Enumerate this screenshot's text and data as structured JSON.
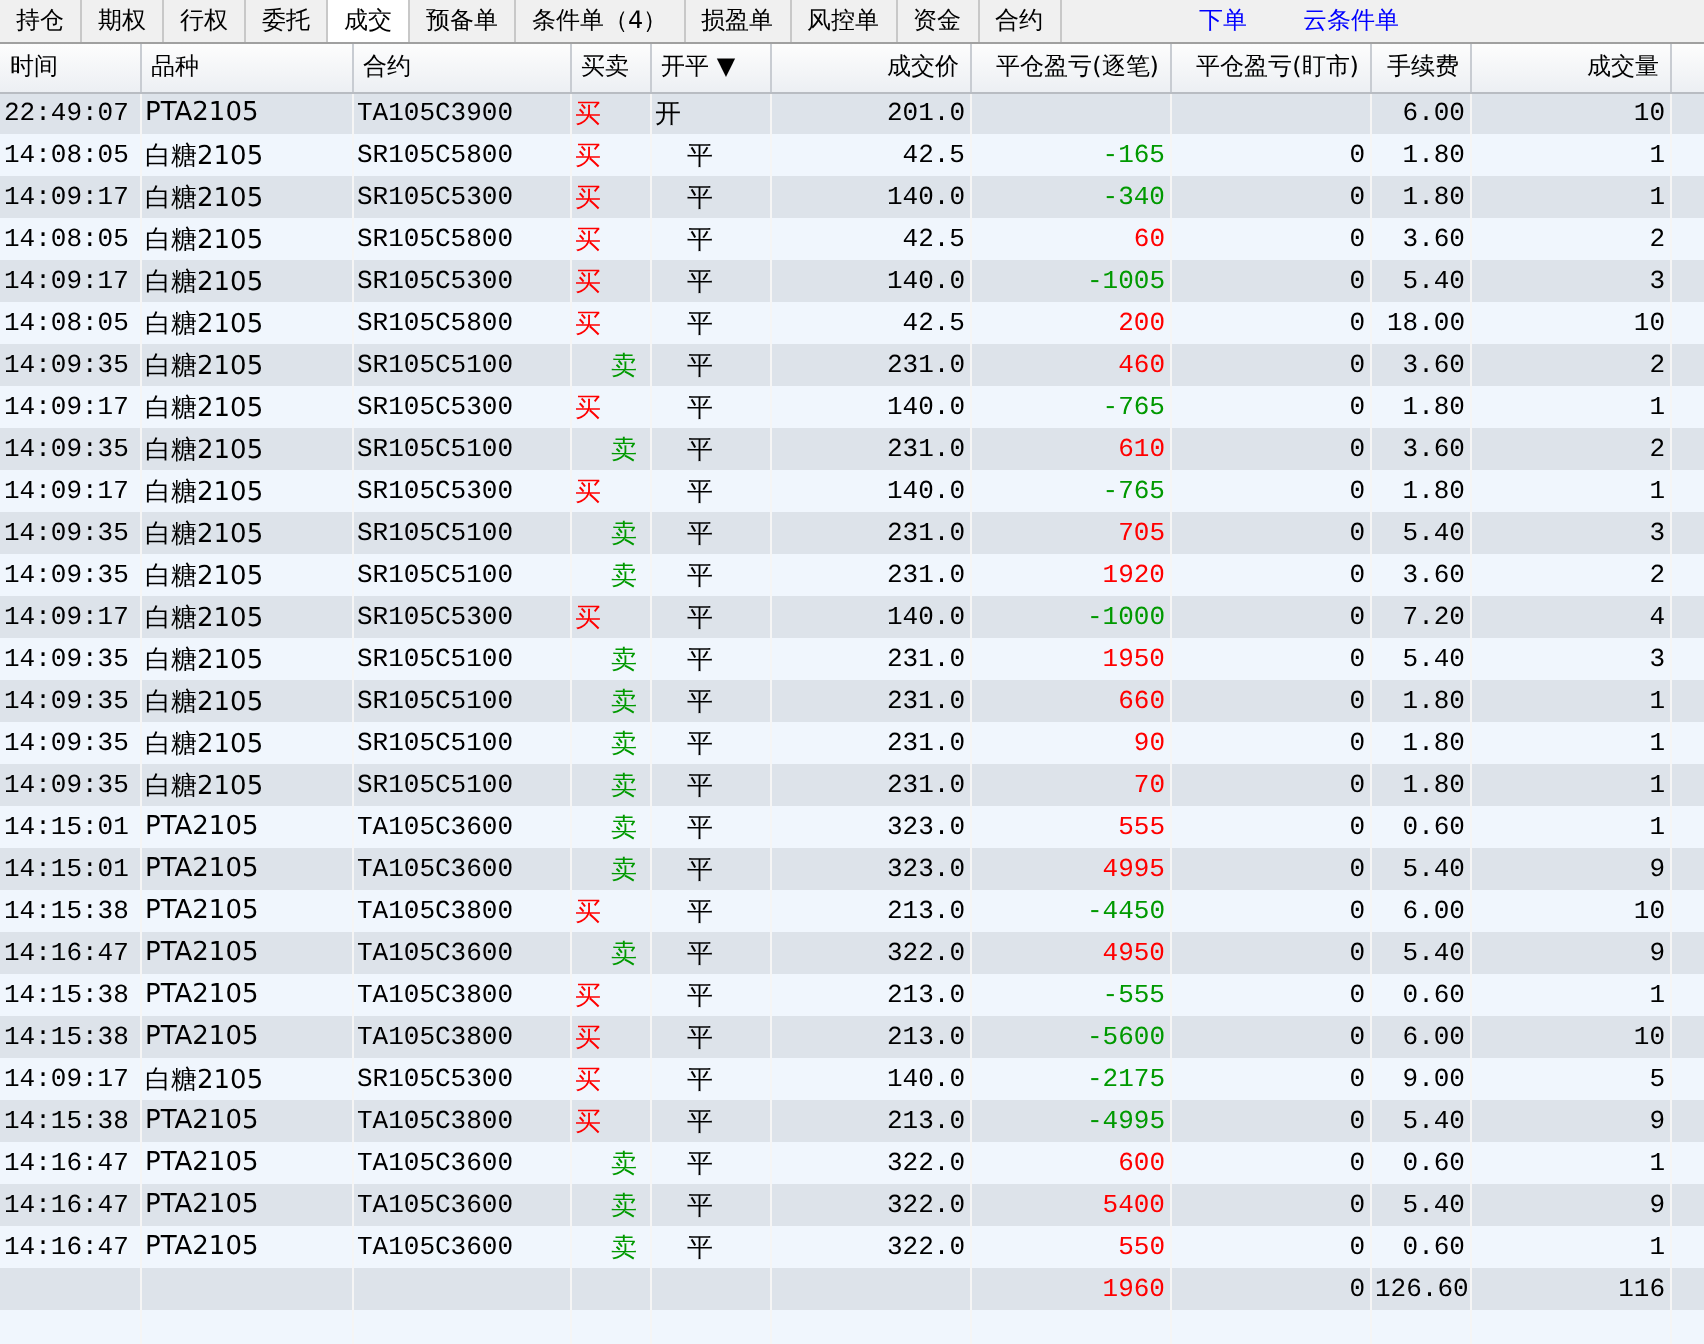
{
  "tabs": [
    {
      "label": "持仓",
      "selected": false
    },
    {
      "label": "期权",
      "selected": false
    },
    {
      "label": "行权",
      "selected": false
    },
    {
      "label": "委托",
      "selected": false
    },
    {
      "label": "成交",
      "selected": true
    },
    {
      "label": "预备单",
      "selected": false
    },
    {
      "label": "条件单（4）",
      "selected": false
    },
    {
      "label": "损盈单",
      "selected": false
    },
    {
      "label": "风控单",
      "selected": false
    },
    {
      "label": "资金",
      "selected": false
    },
    {
      "label": "合约",
      "selected": false
    }
  ],
  "links": [
    "下单",
    "云条件单"
  ],
  "table": {
    "columns": [
      {
        "label": "时间"
      },
      {
        "label": "品种"
      },
      {
        "label": "合约"
      },
      {
        "label": "买卖"
      },
      {
        "label": "开平",
        "sort": "▼"
      },
      {
        "label": "成交价"
      },
      {
        "label": "平仓盈亏(逐笔)"
      },
      {
        "label": "平仓盈亏(盯市)"
      },
      {
        "label": "手续费"
      },
      {
        "label": "成交量"
      }
    ],
    "rows": [
      {
        "time": "22:49:07",
        "product": "PTA2105",
        "contract": "TA105C3900",
        "side": {
          "text": "买",
          "kind": "buy"
        },
        "offset": "开",
        "price": "201.0",
        "fee": "6.00",
        "volume": "10"
      },
      {
        "time": "14:08:05",
        "product": "白糖2105",
        "contract": "SR105C5800",
        "side": {
          "text": "买",
          "kind": "buy"
        },
        "offset": "平",
        "price": "42.5",
        "pnl_trade": {
          "text": "-165",
          "color": "#009900"
        },
        "pnl_mark": "0",
        "fee": "1.80",
        "volume": "1"
      },
      {
        "time": "14:09:17",
        "product": "白糖2105",
        "contract": "SR105C5300",
        "side": {
          "text": "买",
          "kind": "buy"
        },
        "offset": "平",
        "price": "140.0",
        "pnl_trade": {
          "text": "-340",
          "color": "#009900"
        },
        "pnl_mark": "0",
        "fee": "1.80",
        "volume": "1"
      },
      {
        "time": "14:08:05",
        "product": "白糖2105",
        "contract": "SR105C5800",
        "side": {
          "text": "买",
          "kind": "buy"
        },
        "offset": "平",
        "price": "42.5",
        "pnl_trade": {
          "text": "60",
          "color": "#ff0000"
        },
        "pnl_mark": "0",
        "fee": "3.60",
        "volume": "2"
      },
      {
        "time": "14:09:17",
        "product": "白糖2105",
        "contract": "SR105C5300",
        "side": {
          "text": "买",
          "kind": "buy"
        },
        "offset": "平",
        "price": "140.0",
        "pnl_trade": {
          "text": "-1005",
          "color": "#009900"
        },
        "pnl_mark": "0",
        "fee": "5.40",
        "volume": "3"
      },
      {
        "time": "14:08:05",
        "product": "白糖2105",
        "contract": "SR105C5800",
        "side": {
          "text": "买",
          "kind": "buy"
        },
        "offset": "平",
        "price": "42.5",
        "pnl_trade": {
          "text": "200",
          "color": "#ff0000"
        },
        "pnl_mark": "0",
        "fee": "18.00",
        "volume": "10"
      },
      {
        "time": "14:09:35",
        "product": "白糖2105",
        "contract": "SR105C5100",
        "side": {
          "text": "卖",
          "kind": "sell"
        },
        "offset": "平",
        "price": "231.0",
        "pnl_trade": {
          "text": "460",
          "color": "#ff0000"
        },
        "pnl_mark": "0",
        "fee": "3.60",
        "volume": "2"
      },
      {
        "time": "14:09:17",
        "product": "白糖2105",
        "contract": "SR105C5300",
        "side": {
          "text": "买",
          "kind": "buy"
        },
        "offset": "平",
        "price": "140.0",
        "pnl_trade": {
          "text": "-765",
          "color": "#009900"
        },
        "pnl_mark": "0",
        "fee": "1.80",
        "volume": "1"
      },
      {
        "time": "14:09:35",
        "product": "白糖2105",
        "contract": "SR105C5100",
        "side": {
          "text": "卖",
          "kind": "sell"
        },
        "offset": "平",
        "price": "231.0",
        "pnl_trade": {
          "text": "610",
          "color": "#ff0000"
        },
        "pnl_mark": "0",
        "fee": "3.60",
        "volume": "2"
      },
      {
        "time": "14:09:17",
        "product": "白糖2105",
        "contract": "SR105C5300",
        "side": {
          "text": "买",
          "kind": "buy"
        },
        "offset": "平",
        "price": "140.0",
        "pnl_trade": {
          "text": "-765",
          "color": "#009900"
        },
        "pnl_mark": "0",
        "fee": "1.80",
        "volume": "1"
      },
      {
        "time": "14:09:35",
        "product": "白糖2105",
        "contract": "SR105C5100",
        "side": {
          "text": "卖",
          "kind": "sell"
        },
        "offset": "平",
        "price": "231.0",
        "pnl_trade": {
          "text": "705",
          "color": "#ff0000"
        },
        "pnl_mark": "0",
        "fee": "5.40",
        "volume": "3"
      },
      {
        "time": "14:09:35",
        "product": "白糖2105",
        "contract": "SR105C5100",
        "side": {
          "text": "卖",
          "kind": "sell"
        },
        "offset": "平",
        "price": "231.0",
        "pnl_trade": {
          "text": "1920",
          "color": "#ff0000"
        },
        "pnl_mark": "0",
        "fee": "3.60",
        "volume": "2"
      },
      {
        "time": "14:09:17",
        "product": "白糖2105",
        "contract": "SR105C5300",
        "side": {
          "text": "买",
          "kind": "buy"
        },
        "offset": "平",
        "price": "140.0",
        "pnl_trade": {
          "text": "-1000",
          "color": "#009900"
        },
        "pnl_mark": "0",
        "fee": "7.20",
        "volume": "4"
      },
      {
        "time": "14:09:35",
        "product": "白糖2105",
        "contract": "SR105C5100",
        "side": {
          "text": "卖",
          "kind": "sell"
        },
        "offset": "平",
        "price": "231.0",
        "pnl_trade": {
          "text": "1950",
          "color": "#ff0000"
        },
        "pnl_mark": "0",
        "fee": "5.40",
        "volume": "3"
      },
      {
        "time": "14:09:35",
        "product": "白糖2105",
        "contract": "SR105C5100",
        "side": {
          "text": "卖",
          "kind": "sell"
        },
        "offset": "平",
        "price": "231.0",
        "pnl_trade": {
          "text": "660",
          "color": "#ff0000"
        },
        "pnl_mark": "0",
        "fee": "1.80",
        "volume": "1"
      },
      {
        "time": "14:09:35",
        "product": "白糖2105",
        "contract": "SR105C5100",
        "side": {
          "text": "卖",
          "kind": "sell"
        },
        "offset": "平",
        "price": "231.0",
        "pnl_trade": {
          "text": "90",
          "color": "#ff0000"
        },
        "pnl_mark": "0",
        "fee": "1.80",
        "volume": "1"
      },
      {
        "time": "14:09:35",
        "product": "白糖2105",
        "contract": "SR105C5100",
        "side": {
          "text": "卖",
          "kind": "sell"
        },
        "offset": "平",
        "price": "231.0",
        "pnl_trade": {
          "text": "70",
          "color": "#ff0000"
        },
        "pnl_mark": "0",
        "fee": "1.80",
        "volume": "1"
      },
      {
        "time": "14:15:01",
        "product": "PTA2105",
        "contract": "TA105C3600",
        "side": {
          "text": "卖",
          "kind": "sell"
        },
        "offset": "平",
        "price": "323.0",
        "pnl_trade": {
          "text": "555",
          "color": "#ff0000"
        },
        "pnl_mark": "0",
        "fee": "0.60",
        "volume": "1"
      },
      {
        "time": "14:15:01",
        "product": "PTA2105",
        "contract": "TA105C3600",
        "side": {
          "text": "卖",
          "kind": "sell"
        },
        "offset": "平",
        "price": "323.0",
        "pnl_trade": {
          "text": "4995",
          "color": "#ff0000"
        },
        "pnl_mark": "0",
        "fee": "5.40",
        "volume": "9"
      },
      {
        "time": "14:15:38",
        "product": "PTA2105",
        "contract": "TA105C3800",
        "side": {
          "text": "买",
          "kind": "buy"
        },
        "offset": "平",
        "price": "213.0",
        "pnl_trade": {
          "text": "-4450",
          "color": "#009900"
        },
        "pnl_mark": "0",
        "fee": "6.00",
        "volume": "10"
      },
      {
        "time": "14:16:47",
        "product": "PTA2105",
        "contract": "TA105C3600",
        "side": {
          "text": "卖",
          "kind": "sell"
        },
        "offset": "平",
        "price": "322.0",
        "pnl_trade": {
          "text": "4950",
          "color": "#ff0000"
        },
        "pnl_mark": "0",
        "fee": "5.40",
        "volume": "9"
      },
      {
        "time": "14:15:38",
        "product": "PTA2105",
        "contract": "TA105C3800",
        "side": {
          "text": "买",
          "kind": "buy"
        },
        "offset": "平",
        "price": "213.0",
        "pnl_trade": {
          "text": "-555",
          "color": "#009900"
        },
        "pnl_mark": "0",
        "fee": "0.60",
        "volume": "1"
      },
      {
        "time": "14:15:38",
        "product": "PTA2105",
        "contract": "TA105C3800",
        "side": {
          "text": "买",
          "kind": "buy"
        },
        "offset": "平",
        "price": "213.0",
        "pnl_trade": {
          "text": "-5600",
          "color": "#009900"
        },
        "pnl_mark": "0",
        "fee": "6.00",
        "volume": "10"
      },
      {
        "time": "14:09:17",
        "product": "白糖2105",
        "contract": "SR105C5300",
        "side": {
          "text": "买",
          "kind": "buy"
        },
        "offset": "平",
        "price": "140.0",
        "pnl_trade": {
          "text": "-2175",
          "color": "#009900"
        },
        "pnl_mark": "0",
        "fee": "9.00",
        "volume": "5"
      },
      {
        "time": "14:15:38",
        "product": "PTA2105",
        "contract": "TA105C3800",
        "side": {
          "text": "买",
          "kind": "buy"
        },
        "offset": "平",
        "price": "213.0",
        "pnl_trade": {
          "text": "-4995",
          "color": "#009900"
        },
        "pnl_mark": "0",
        "fee": "5.40",
        "volume": "9"
      },
      {
        "time": "14:16:47",
        "product": "PTA2105",
        "contract": "TA105C3600",
        "side": {
          "text": "卖",
          "kind": "sell"
        },
        "offset": "平",
        "price": "322.0",
        "pnl_trade": {
          "text": "600",
          "color": "#ff0000"
        },
        "pnl_mark": "0",
        "fee": "0.60",
        "volume": "1"
      },
      {
        "time": "14:16:47",
        "product": "PTA2105",
        "contract": "TA105C3600",
        "side": {
          "text": "卖",
          "kind": "sell"
        },
        "offset": "平",
        "price": "322.0",
        "pnl_trade": {
          "text": "5400",
          "color": "#ff0000"
        },
        "pnl_mark": "0",
        "fee": "5.40",
        "volume": "9"
      },
      {
        "time": "14:16:47",
        "product": "PTA2105",
        "contract": "TA105C3600",
        "side": {
          "text": "卖",
          "kind": "sell"
        },
        "offset": "平",
        "price": "322.0",
        "pnl_trade": {
          "text": "550",
          "color": "#ff0000"
        },
        "pnl_mark": "0",
        "fee": "0.60",
        "volume": "1"
      }
    ],
    "totals": {
      "pnl_trade": {
        "text": "1960",
        "color": "#ff0000"
      },
      "pnl_mark": "0",
      "fee": "126.60",
      "volume": "116"
    }
  }
}
